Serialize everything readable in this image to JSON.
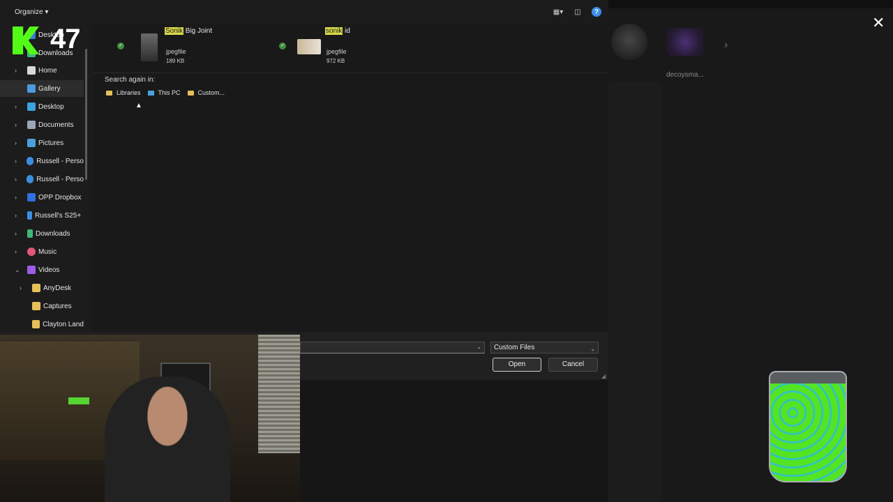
{
  "toolbar": {
    "organize_label": "Organize ▾"
  },
  "sidebar": {
    "items": [
      {
        "label": "Desktop",
        "icon": "desktop-icon",
        "partial": true
      },
      {
        "label": "Downloads",
        "icon": "downloads-icon",
        "partial": true
      },
      {
        "label": "Home",
        "icon": "home-icon"
      },
      {
        "label": "Gallery",
        "icon": "gallery-icon",
        "selected": true
      },
      {
        "label": "Desktop",
        "icon": "desktop-icon"
      },
      {
        "label": "Documents",
        "icon": "documents-icon"
      },
      {
        "label": "Pictures",
        "icon": "pictures-icon"
      },
      {
        "label": "Russell - Perso",
        "icon": "onedrive-icon"
      },
      {
        "label": "Russell - Perso",
        "icon": "onedrive-icon"
      },
      {
        "label": "OPP Dropbox",
        "icon": "dropbox-icon"
      },
      {
        "label": "Russell's S25+",
        "icon": "phone-icon"
      },
      {
        "label": "Downloads",
        "icon": "downloads-icon"
      },
      {
        "label": "Music",
        "icon": "music-icon"
      },
      {
        "label": "Videos",
        "icon": "videos-icon",
        "expanded": true
      },
      {
        "label": "AnyDesk",
        "icon": "folder-icon"
      },
      {
        "label": "Captures",
        "icon": "folder-icon"
      },
      {
        "label": "Clayton Land",
        "icon": "folder-icon"
      }
    ]
  },
  "files": [
    {
      "highlight": "Sonik",
      "rest": " Big Joint",
      "type": "jpegfile",
      "size": "189 KB"
    },
    {
      "highlight": "sonik",
      "rest": " id",
      "type": "jpegfile",
      "size": "972 KB"
    }
  ],
  "search_again": {
    "label": "Search again in:",
    "locations": [
      "Libraries",
      "This PC",
      "Custom..."
    ]
  },
  "bottom": {
    "filename_value": "",
    "filter_value": "Custom Files",
    "open_label": "Open",
    "cancel_label": "Cancel"
  },
  "overlay": {
    "logo_number": "47",
    "side_user": "decoysma..."
  },
  "colors": {
    "accent": "#53fc18",
    "highlight": "#d8d94a",
    "help": "#3d8ee8"
  }
}
